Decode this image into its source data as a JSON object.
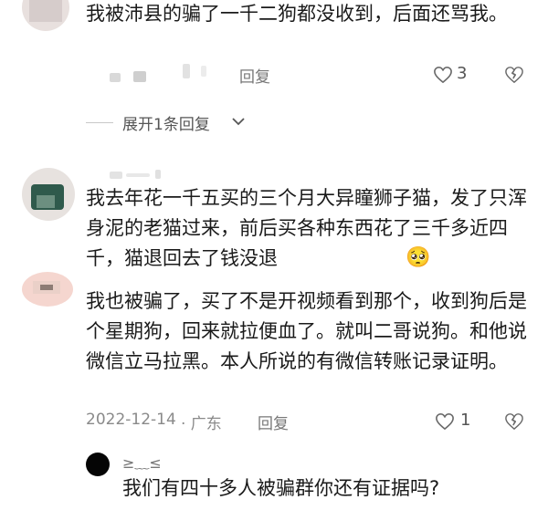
{
  "comments": [
    {
      "text": "我被沛县的骗了一千二狗都没收到，后面还骂我。",
      "reply_label": "回复",
      "like_count": "3",
      "expand_label": "展开1条回复"
    },
    {
      "text": "我去年花一千五买的三个月大异瞳狮子猫，发了只浑身泥的老猫过来，前后买各种东西花了三千多近四千，猫退回去了钱没退",
      "emoji": "🥺"
    },
    {
      "text": "我也被骗了，买了不是开视频看到那个，收到狗后是个星期狗，回来就拉便血了。就叫二哥说狗。和他说微信立马拉黑。本人所说的有微信转账记录证明。",
      "date": "2022-12-14",
      "location": "· 广东",
      "reply_label": "回复",
      "like_count": "1"
    }
  ],
  "reply": {
    "username": "≥﹏≤",
    "text": "我们有四十多人被骗群你还有证据吗?"
  },
  "colors": {
    "text": "#1a1a1a",
    "meta": "#8a8a8a",
    "divider": "#c8c8c8"
  },
  "icons": [
    "heart-icon",
    "broken-heart-icon",
    "chevron-down-icon",
    "avatar"
  ]
}
